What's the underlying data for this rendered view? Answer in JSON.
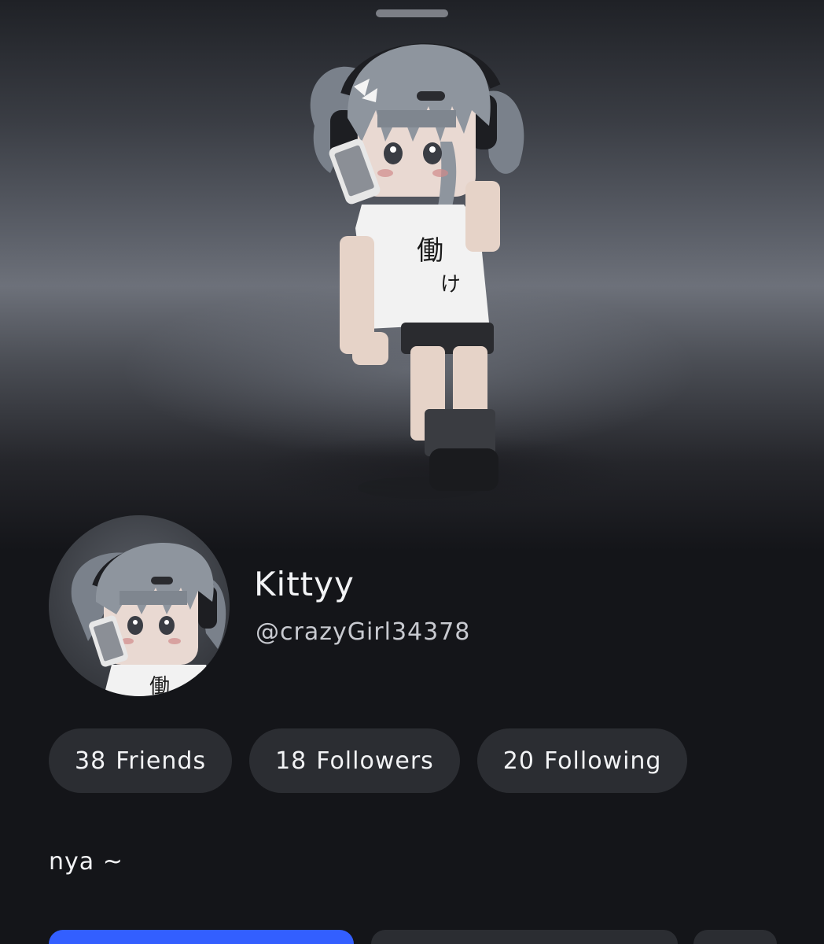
{
  "profile": {
    "display_name": "Kittyy",
    "username": "@crazyGirl34378",
    "bio": "nya ~",
    "avatar_image": "roblox-avatar-3d-icon",
    "headshot_image": "avatar-headshot-icon"
  },
  "stats": [
    {
      "count": "38",
      "label": "Friends"
    },
    {
      "count": "18",
      "label": "Followers"
    },
    {
      "count": "20",
      "label": "Following"
    }
  ],
  "colors": {
    "background": "#141519",
    "pill": "#2b2d32",
    "primary_button": "#335fff",
    "text": "#f2f3f5"
  }
}
